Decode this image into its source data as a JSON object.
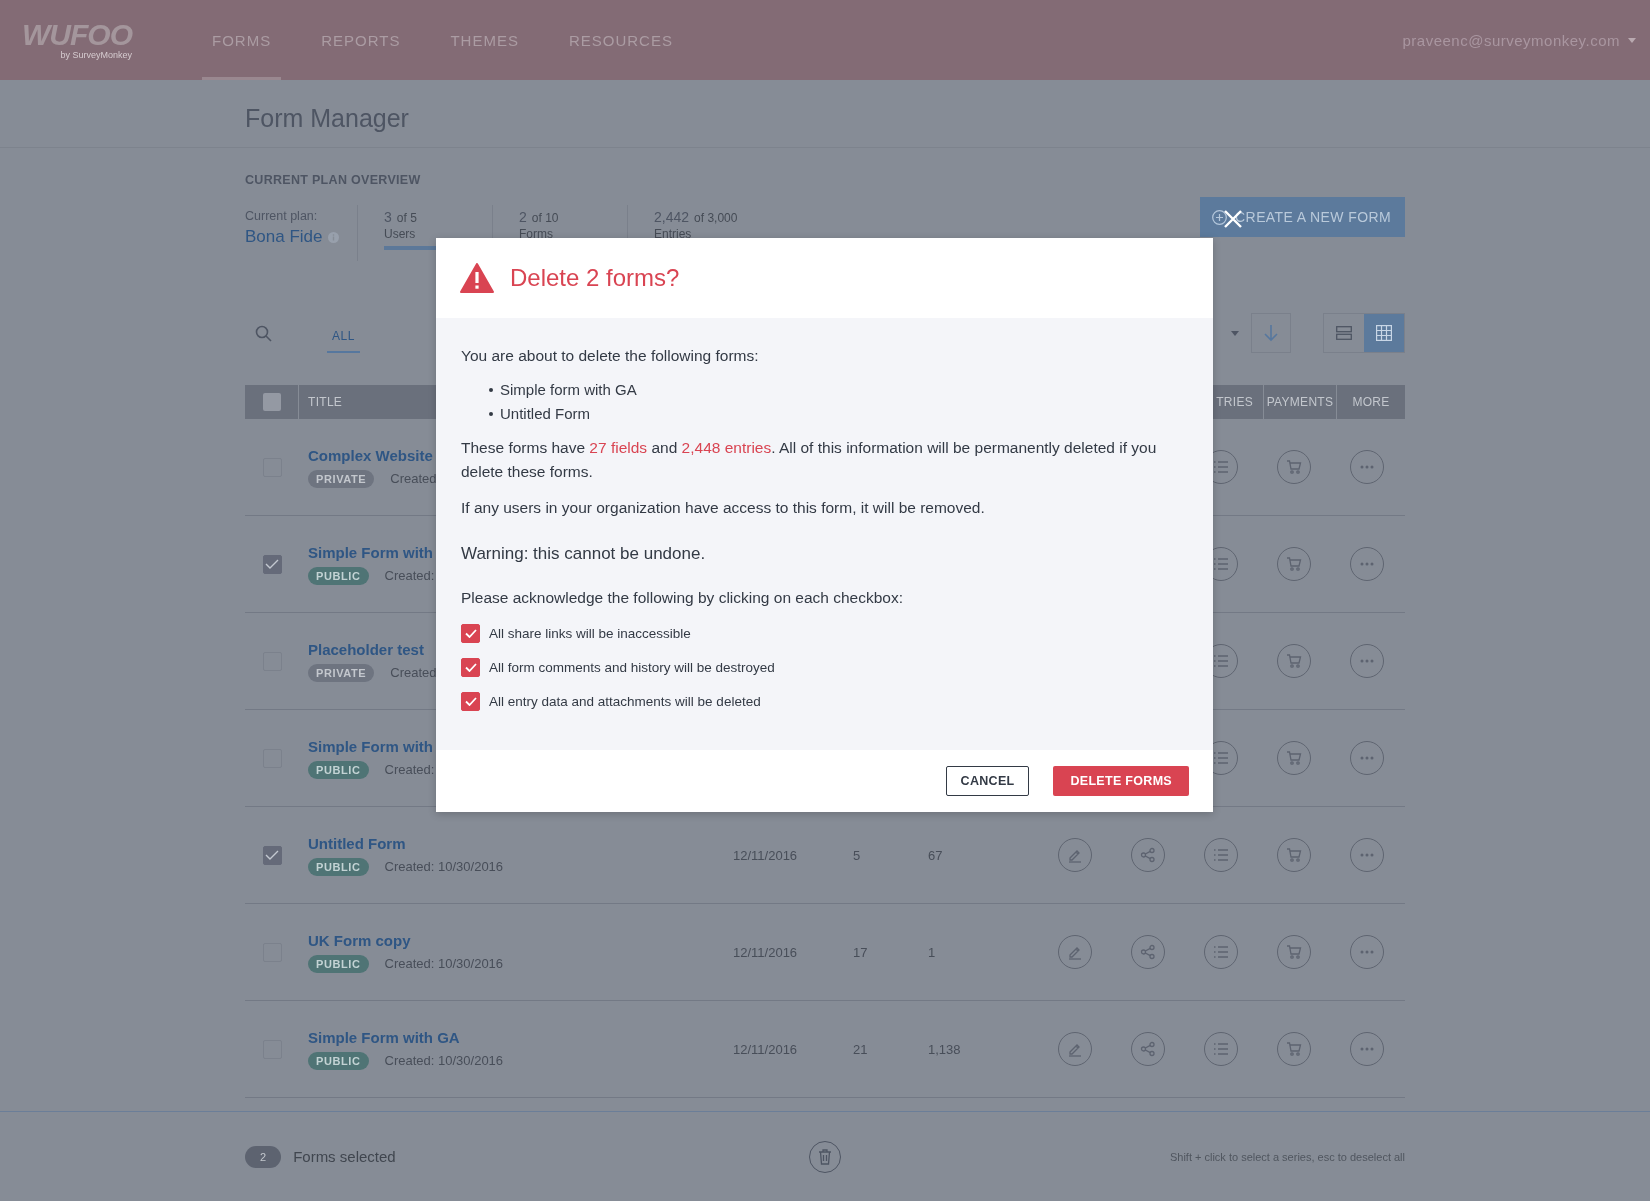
{
  "header": {
    "logo": "WUFOO",
    "logo_sub": "by SurveyMonkey",
    "nav": [
      {
        "label": "FORMS",
        "selected": true
      },
      {
        "label": "REPORTS",
        "selected": false
      },
      {
        "label": "THEMES",
        "selected": false
      },
      {
        "label": "RESOURCES",
        "selected": false
      }
    ],
    "user": "praveenc@surveymonkey.com"
  },
  "page_title": "Form Manager",
  "plan": {
    "heading": "CURRENT PLAN OVERVIEW",
    "plan_label": "Current plan:",
    "plan_name": "Bona Fide",
    "stats": [
      {
        "value": "3",
        "of": "of 5",
        "label": "Users",
        "level": 0.55
      },
      {
        "value": "2",
        "of": "of 10",
        "label": "Forms"
      },
      {
        "value": "2,442",
        "of": "of 3,000",
        "label": "Entries"
      }
    ],
    "create_button": "CREATE A NEW FORM"
  },
  "toolbar": {
    "tabs": [
      {
        "label": "ALL",
        "selected": true
      }
    ],
    "views": [
      {
        "kind": "list",
        "selected": false
      },
      {
        "kind": "grid",
        "selected": true
      }
    ]
  },
  "table": {
    "select_all": {
      "checked": false
    },
    "columns": [
      "TITLE",
      "TRIES",
      "PAYMENTS",
      "MORE"
    ],
    "rows": [
      {
        "title": "Complex Website",
        "visibility": "PRIVATE",
        "kind": "private",
        "created": "Created",
        "checked": false
      },
      {
        "title": "Simple Form with",
        "visibility": "PUBLIC",
        "kind": "public",
        "created": "Created:",
        "checked": true
      },
      {
        "title": "Placeholder test",
        "visibility": "PRIVATE",
        "kind": "private",
        "created": "Created",
        "checked": false
      },
      {
        "title": "Simple Form with",
        "visibility": "PUBLIC",
        "kind": "public",
        "created": "Created:",
        "checked": false
      },
      {
        "title": "Untitled Form",
        "visibility": "PUBLIC",
        "kind": "public",
        "created": "Created: 10/30/2016",
        "checked": true,
        "date": "12/11/2016",
        "fields": "5",
        "entries": "67"
      },
      {
        "title": "UK Form copy",
        "visibility": "PUBLIC",
        "kind": "public",
        "created": "Created: 10/30/2016",
        "checked": false,
        "date": "12/11/2016",
        "fields": "17",
        "entries": "1"
      },
      {
        "title": "Simple Form with GA",
        "visibility": "PUBLIC",
        "kind": "public",
        "created": "Created: 10/30/2016",
        "checked": false,
        "date": "12/11/2016",
        "fields": "21",
        "entries": "1,138"
      }
    ]
  },
  "footer": {
    "count": "2",
    "label": "Forms selected",
    "hint": "Shift + click to select a series, esc to deselect all"
  },
  "dialog": {
    "title": "Delete 2 forms?",
    "intro": "You are about to delete the following forms:",
    "forms": [
      "Simple form with GA",
      "Untitled Form"
    ],
    "summary": [
      {
        "text": "These forms have ",
        "highlight": false
      },
      {
        "text": "27 fields",
        "highlight": true
      },
      {
        "text": " and ",
        "highlight": false
      },
      {
        "text": "2,448 entries",
        "highlight": true
      },
      {
        "text": ". All of this information will be permanently deleted if you delete these forms.",
        "highlight": false
      }
    ],
    "access_note": "If any users in your organization have access to this form, it will be removed.",
    "warning": "Warning: this cannot be undone.",
    "ack_prompt": "Please acknowledge the following by clicking on each checkbox:",
    "acks": [
      {
        "label": "All share links will be inaccessible",
        "checked": true
      },
      {
        "label": "All form comments and history will be destroyed",
        "checked": true
      },
      {
        "label": "All entry data and attachments will be deleted",
        "checked": true
      }
    ],
    "cancel": "CANCEL",
    "confirm": "DELETE FORMS"
  }
}
